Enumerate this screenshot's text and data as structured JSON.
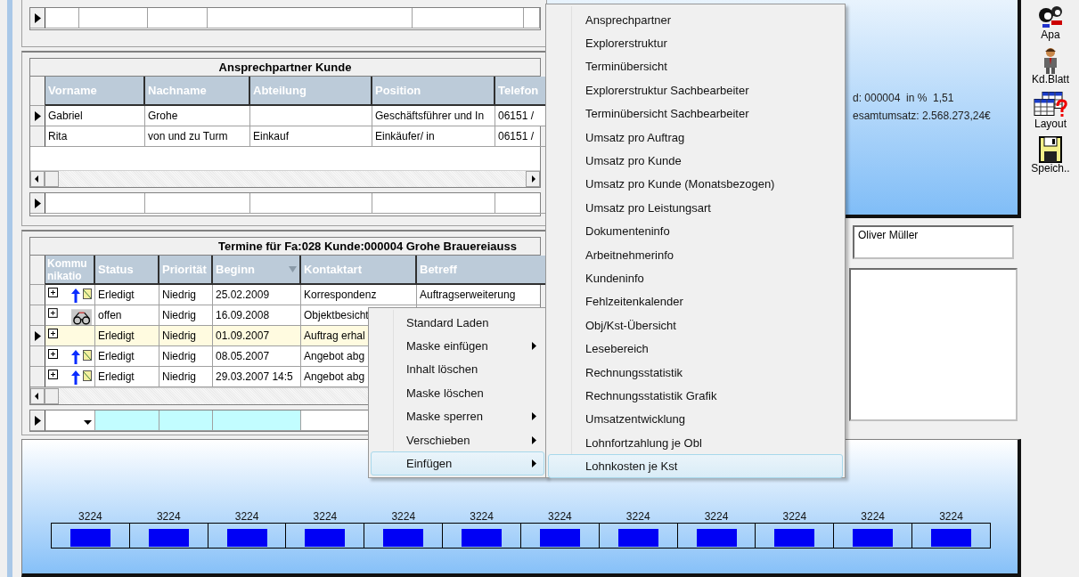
{
  "contacts": {
    "title": "Ansprechpartner Kunde",
    "columns": [
      "Vorname",
      "Nachname",
      "Abteilung",
      "Position",
      "Telefon"
    ],
    "rows": [
      {
        "selected": true,
        "cells": [
          "Gabriel",
          "Grohe",
          "",
          "Geschäftsführer und In",
          "06151 /"
        ]
      },
      {
        "selected": false,
        "cells": [
          "Rita",
          "von und zu Turm",
          "Einkauf",
          "Einkäufer/ in",
          "06151 /"
        ]
      }
    ]
  },
  "appointments": {
    "title": "Termine für Fa:028 Kunde:000004 Grohe Brauereiauss",
    "columns": [
      {
        "label": "Kommunikatio",
        "sorted": false
      },
      {
        "label": "Status",
        "sorted": false
      },
      {
        "label": "Priorität",
        "sorted": false
      },
      {
        "label": "Beginn",
        "sorted": true
      },
      {
        "label": "Kontaktart",
        "sorted": false
      },
      {
        "label": "Betreff",
        "sorted": false
      }
    ],
    "rows": [
      {
        "selected": false,
        "kind": "outgoing",
        "cells": [
          "",
          "Erledigt",
          "Niedrig",
          "25.02.2009",
          "Korrespondenz",
          "Auftragserweiterung"
        ]
      },
      {
        "selected": false,
        "kind": "visit",
        "cells": [
          "",
          "offen",
          "Niedrig",
          "16.09.2008",
          "Objektbesicht"
        ]
      },
      {
        "selected": true,
        "kind": "plain",
        "cells": [
          "",
          "Erledigt",
          "Niedrig",
          "01.09.2007",
          "Auftrag erhal"
        ]
      },
      {
        "selected": false,
        "kind": "outgoing",
        "cells": [
          "",
          "Erledigt",
          "Niedrig",
          "08.05.2007",
          "Angebot abg"
        ]
      },
      {
        "selected": false,
        "kind": "outgoing",
        "cells": [
          "",
          "Erledigt",
          "Niedrig",
          "29.03.2007 14:5",
          "Angebot abg"
        ]
      }
    ]
  },
  "summary": {
    "lines": [
      "d: 000004  in %  1,51",
      "esamtumsatz: 2.568.273,24€"
    ]
  },
  "employee_field": {
    "value": "Oliver Müller"
  },
  "timeline": {
    "cells": [
      {
        "label": "3224"
      },
      {
        "label": "3224"
      },
      {
        "label": "3224"
      },
      {
        "label": "3224"
      },
      {
        "label": "3224"
      },
      {
        "label": "3224"
      },
      {
        "label": "3224"
      },
      {
        "label": "3224"
      },
      {
        "label": "3224"
      },
      {
        "label": "3224"
      },
      {
        "label": "3224"
      },
      {
        "label": "3224"
      }
    ]
  },
  "toolbar": [
    {
      "label": "Apa",
      "kind": "contacts"
    },
    {
      "label": "Kd.Blatt",
      "kind": "person"
    },
    {
      "label": "Layout",
      "kind": "layout"
    },
    {
      "label": "Speich..",
      "kind": "save"
    }
  ],
  "context_menu": {
    "items": [
      {
        "label": "Standard Laden",
        "submenu": false,
        "selected": false
      },
      {
        "label": "Maske einfügen",
        "submenu": true,
        "selected": false
      },
      {
        "label": "Inhalt löschen",
        "submenu": false,
        "selected": false
      },
      {
        "label": "Maske löschen",
        "submenu": false,
        "selected": false
      },
      {
        "label": "Maske sperren",
        "submenu": true,
        "selected": false
      },
      {
        "label": "Verschieben",
        "submenu": true,
        "selected": false
      },
      {
        "label": "Einfügen",
        "submenu": true,
        "selected": true
      }
    ]
  },
  "submenu": {
    "items": [
      {
        "label": "Ansprechpartner",
        "selected": false
      },
      {
        "label": "Explorerstruktur",
        "selected": false
      },
      {
        "label": "Terminübersicht",
        "selected": false
      },
      {
        "label": "Explorerstruktur Sachbearbeiter",
        "selected": false
      },
      {
        "label": "Terminübersicht Sachbearbeiter",
        "selected": false
      },
      {
        "label": "Umsatz pro Auftrag",
        "selected": false
      },
      {
        "label": "Umsatz pro Kunde",
        "selected": false
      },
      {
        "label": "Umsatz pro Kunde (Monatsbezogen)",
        "selected": false
      },
      {
        "label": "Umsatz pro Leistungsart",
        "selected": false
      },
      {
        "label": "Dokumenteninfo",
        "selected": false
      },
      {
        "label": "Arbeitnehmerinfo",
        "selected": false
      },
      {
        "label": "Kundeninfo",
        "selected": false
      },
      {
        "label": "Fehlzeitenkalender",
        "selected": false
      },
      {
        "label": "Obj/Kst-Übersicht",
        "selected": false
      },
      {
        "label": "Lesebereich",
        "selected": false
      },
      {
        "label": "Rechnungsstatistik",
        "selected": false
      },
      {
        "label": "Rechnungsstatistik Grafik",
        "selected": false
      },
      {
        "label": "Umsatzentwicklung",
        "selected": false
      },
      {
        "label": "Lohnfortzahlung je Obl",
        "selected": false
      },
      {
        "label": "Lohnkosten je Kst",
        "selected": true
      }
    ]
  }
}
